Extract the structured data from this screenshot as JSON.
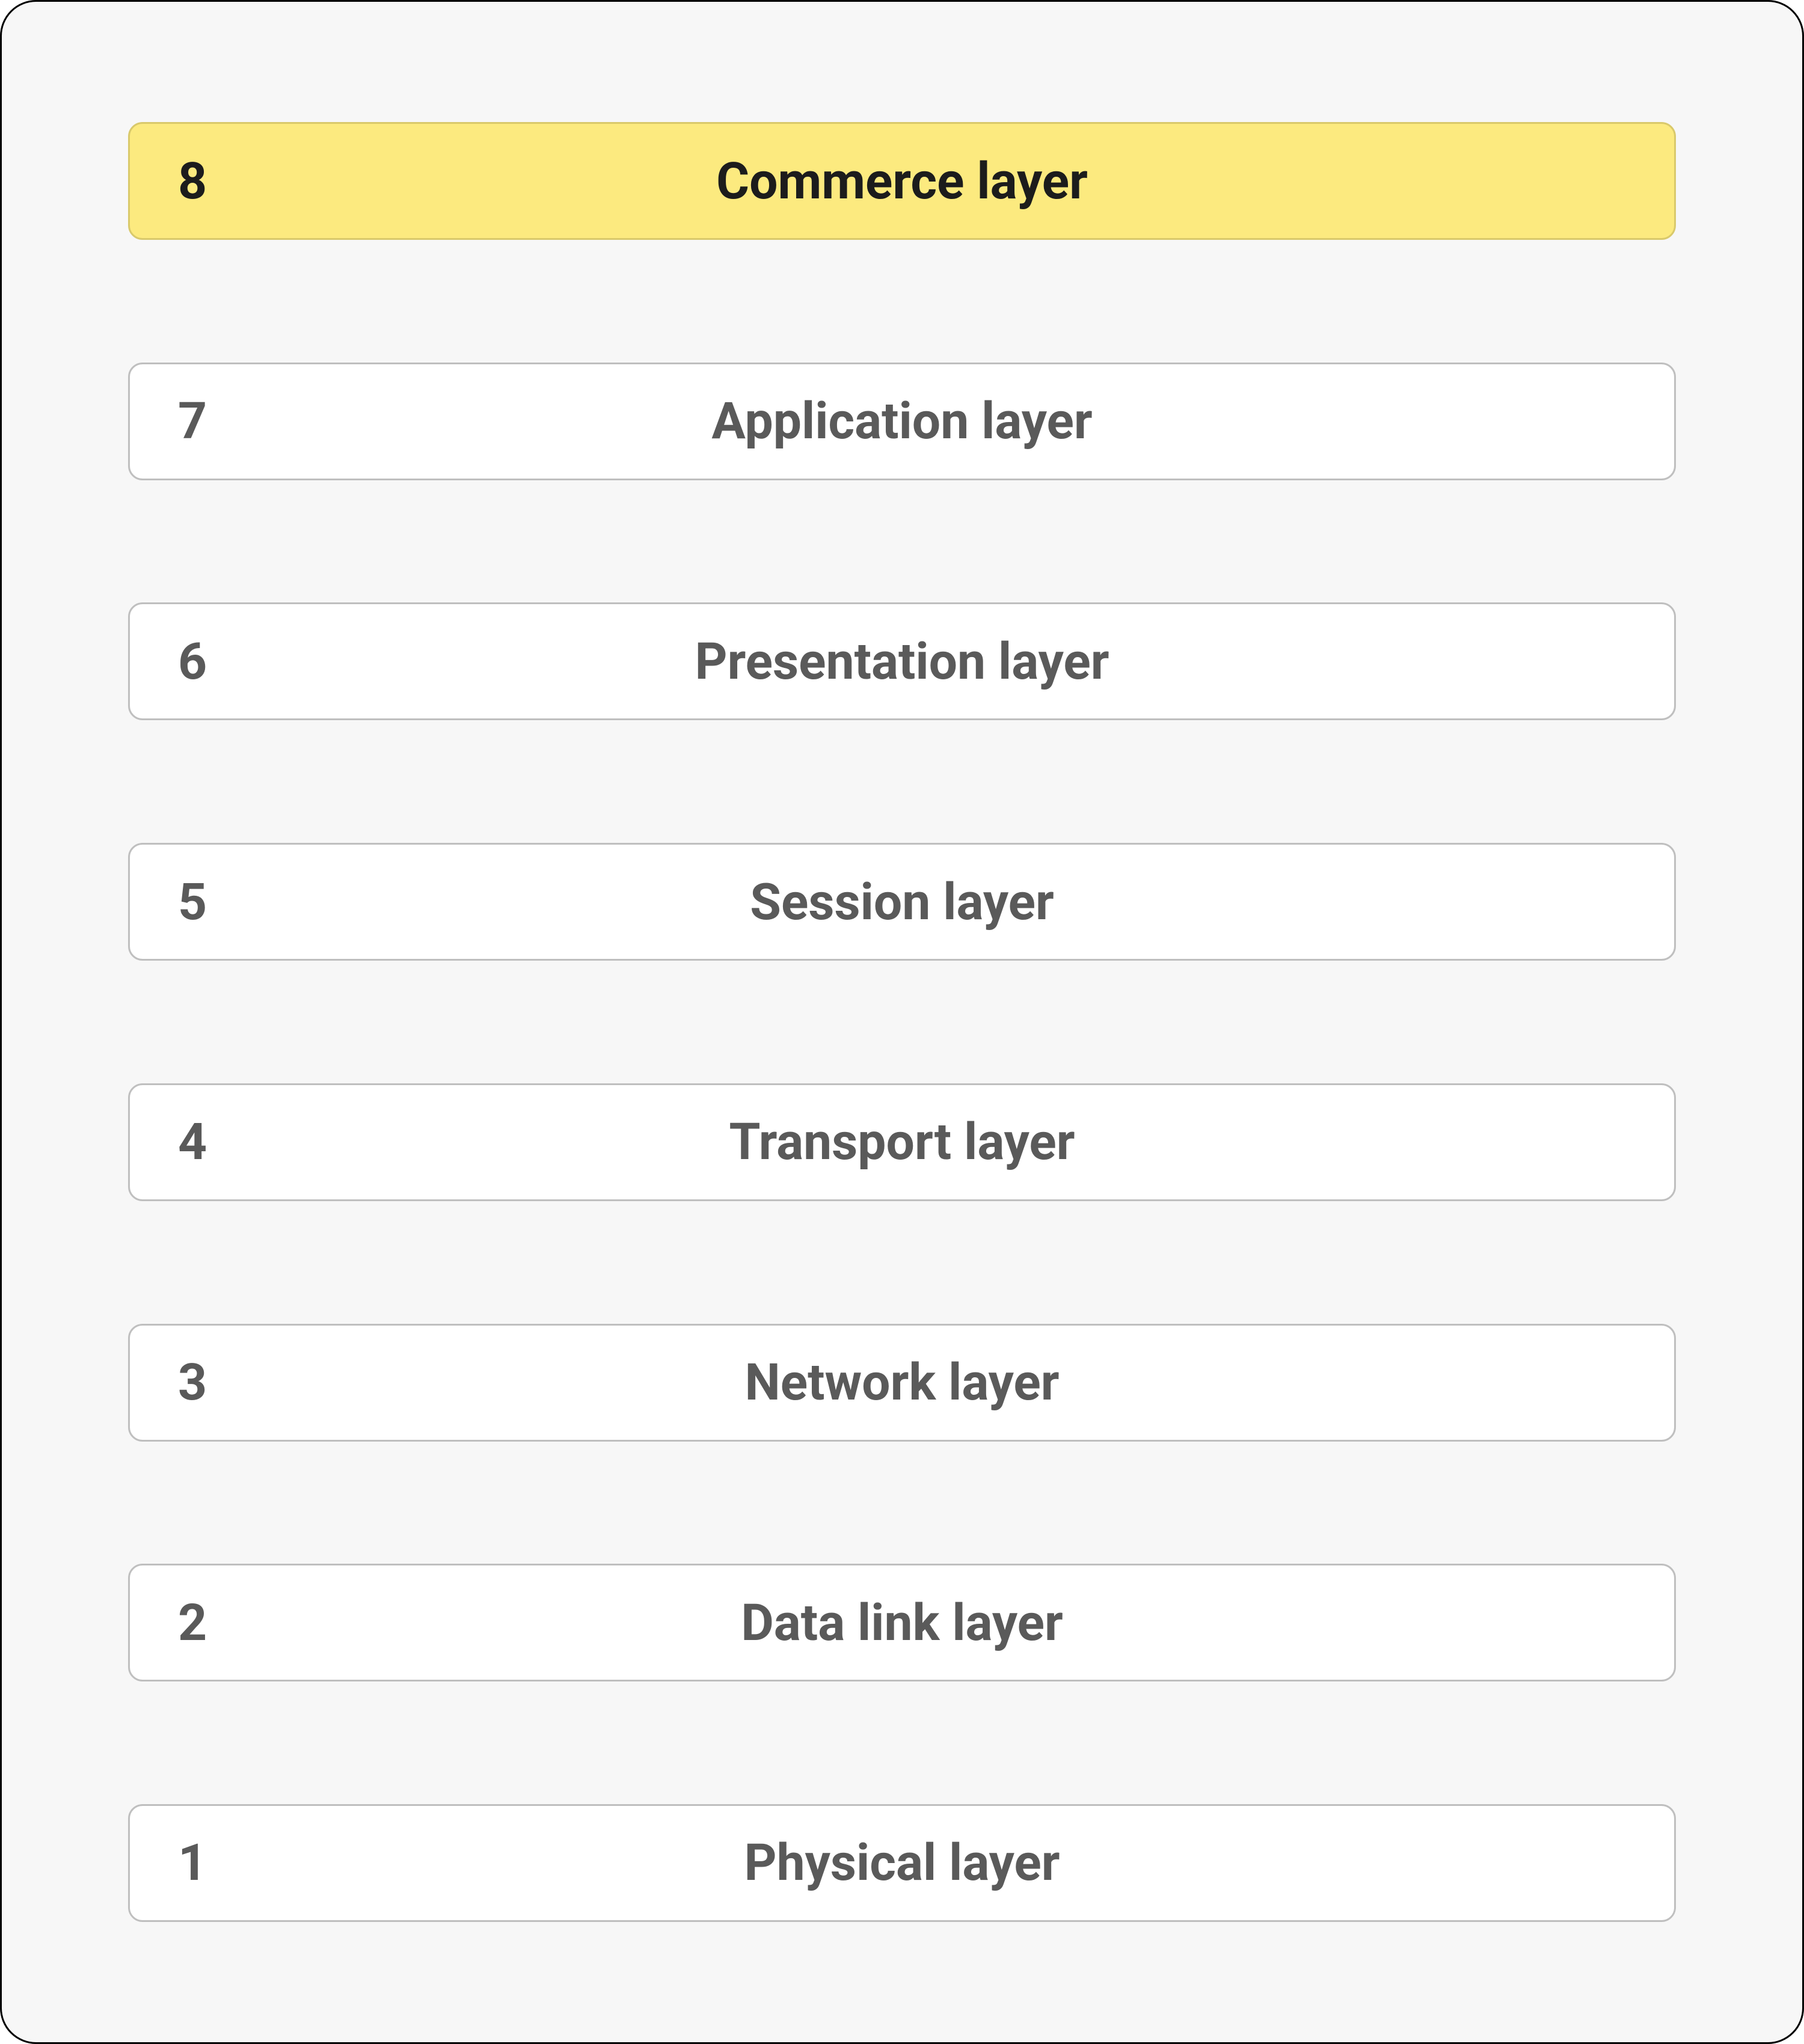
{
  "layers": [
    {
      "number": "8",
      "name": "Commerce layer",
      "highlight": true
    },
    {
      "number": "7",
      "name": "Application layer",
      "highlight": false
    },
    {
      "number": "6",
      "name": "Presentation layer",
      "highlight": false
    },
    {
      "number": "5",
      "name": "Session layer",
      "highlight": false
    },
    {
      "number": "4",
      "name": "Transport layer",
      "highlight": false
    },
    {
      "number": "3",
      "name": "Network layer",
      "highlight": false
    },
    {
      "number": "2",
      "name": "Data link layer",
      "highlight": false
    },
    {
      "number": "1",
      "name": "Physical layer",
      "highlight": false
    }
  ],
  "colors": {
    "highlight_bg": "#fcea7f",
    "highlight_border": "#d9c96b",
    "row_bg": "#ffffff",
    "row_border": "#bfbfbf",
    "frame_bg": "#f7f7f7",
    "text_default": "#5a5a5a",
    "text_highlight": "#1c1c1c"
  }
}
